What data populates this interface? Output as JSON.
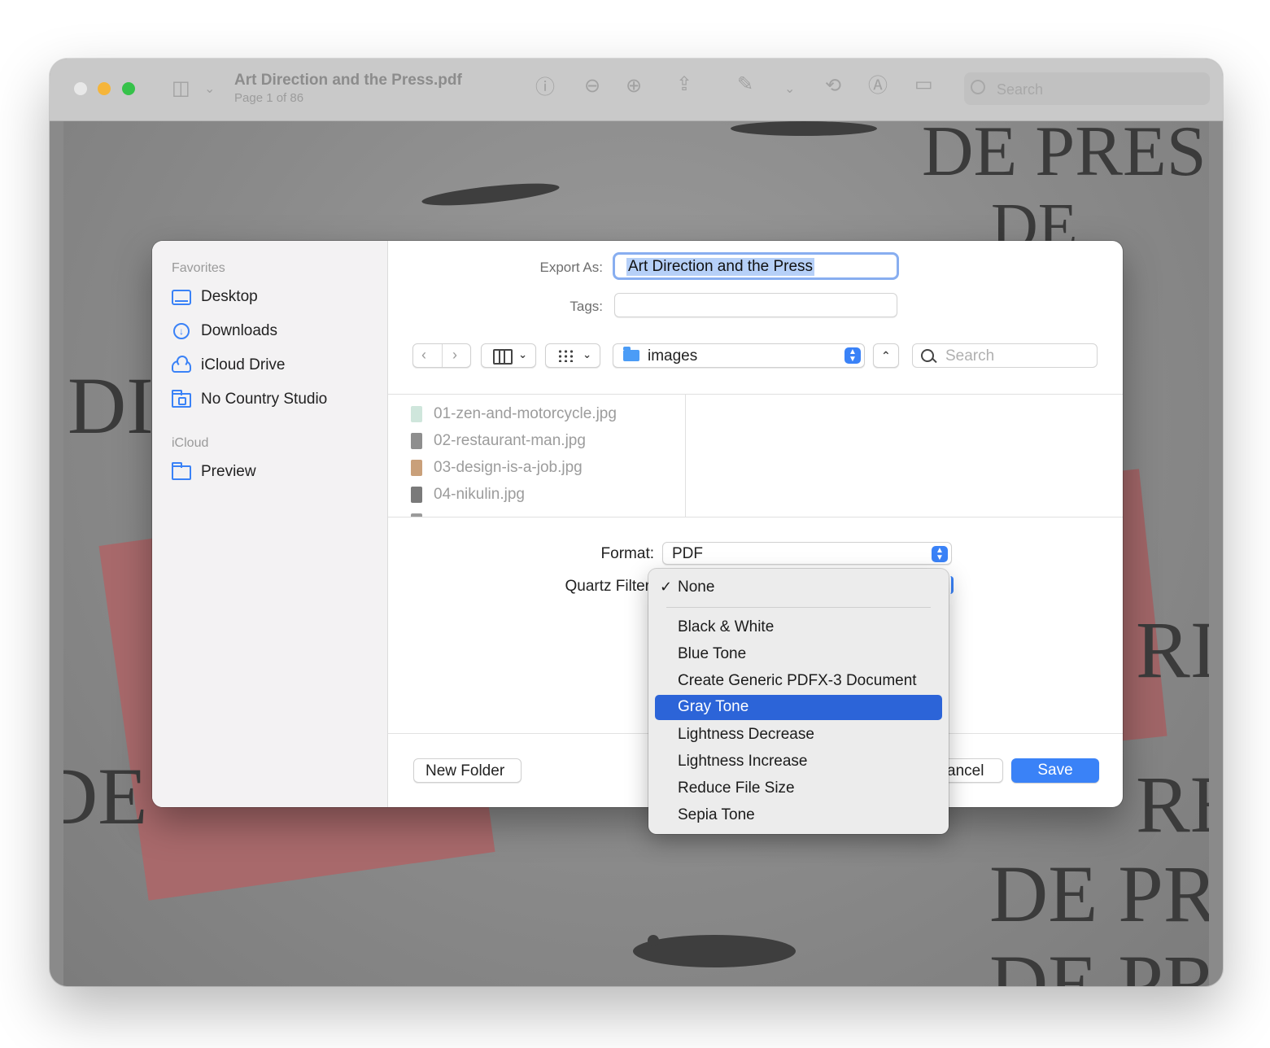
{
  "window": {
    "doc_title": "Art Direction and the Press.pdf",
    "doc_subtitle": "Page 1 of 86",
    "search_placeholder": "Search"
  },
  "background_text": [
    "DE PRES",
    "DE",
    "DI",
    "DE",
    "RI",
    "RE",
    "DE PR",
    "DE PR"
  ],
  "dialog": {
    "export_as_label": "Export As:",
    "export_as_value": "Art Direction and the Press",
    "tags_label": "Tags:",
    "location": "images",
    "search_placeholder": "Search",
    "sidebar": {
      "favorites_header": "Favorites",
      "favorites": [
        {
          "label": "Desktop",
          "icon": "desktop-icon"
        },
        {
          "label": "Downloads",
          "icon": "download-icon"
        },
        {
          "label": "iCloud Drive",
          "icon": "cloud-icon"
        },
        {
          "label": "No Country Studio",
          "icon": "folder-icon"
        }
      ],
      "icloud_header": "iCloud",
      "icloud": [
        {
          "label": "Preview",
          "icon": "folder-icon"
        }
      ]
    },
    "files": [
      {
        "name": "01-zen-and-motorcycle.jpg",
        "color": "#cfe6dc"
      },
      {
        "name": "02-restaurant-man.jpg",
        "color": "#8e8e8e"
      },
      {
        "name": "03-design-is-a-job.jpg",
        "color": "#c9a07a"
      },
      {
        "name": "04-nikulin.jpg",
        "color": "#7a7a7a"
      }
    ],
    "format_label": "Format:",
    "format_value": "PDF",
    "quartz_label": "Quartz Filter",
    "new_folder_label": "New Folder",
    "cancel_label": "ancel",
    "save_label": "Save",
    "accent_color": "#3a82f7"
  },
  "quartz_menu": {
    "checked": "None",
    "items": [
      "Black & White",
      "Blue Tone",
      "Create Generic PDFX-3 Document",
      "Gray Tone",
      "Lightness Decrease",
      "Lightness Increase",
      "Reduce File Size",
      "Sepia Tone"
    ],
    "selected": "Gray Tone"
  }
}
